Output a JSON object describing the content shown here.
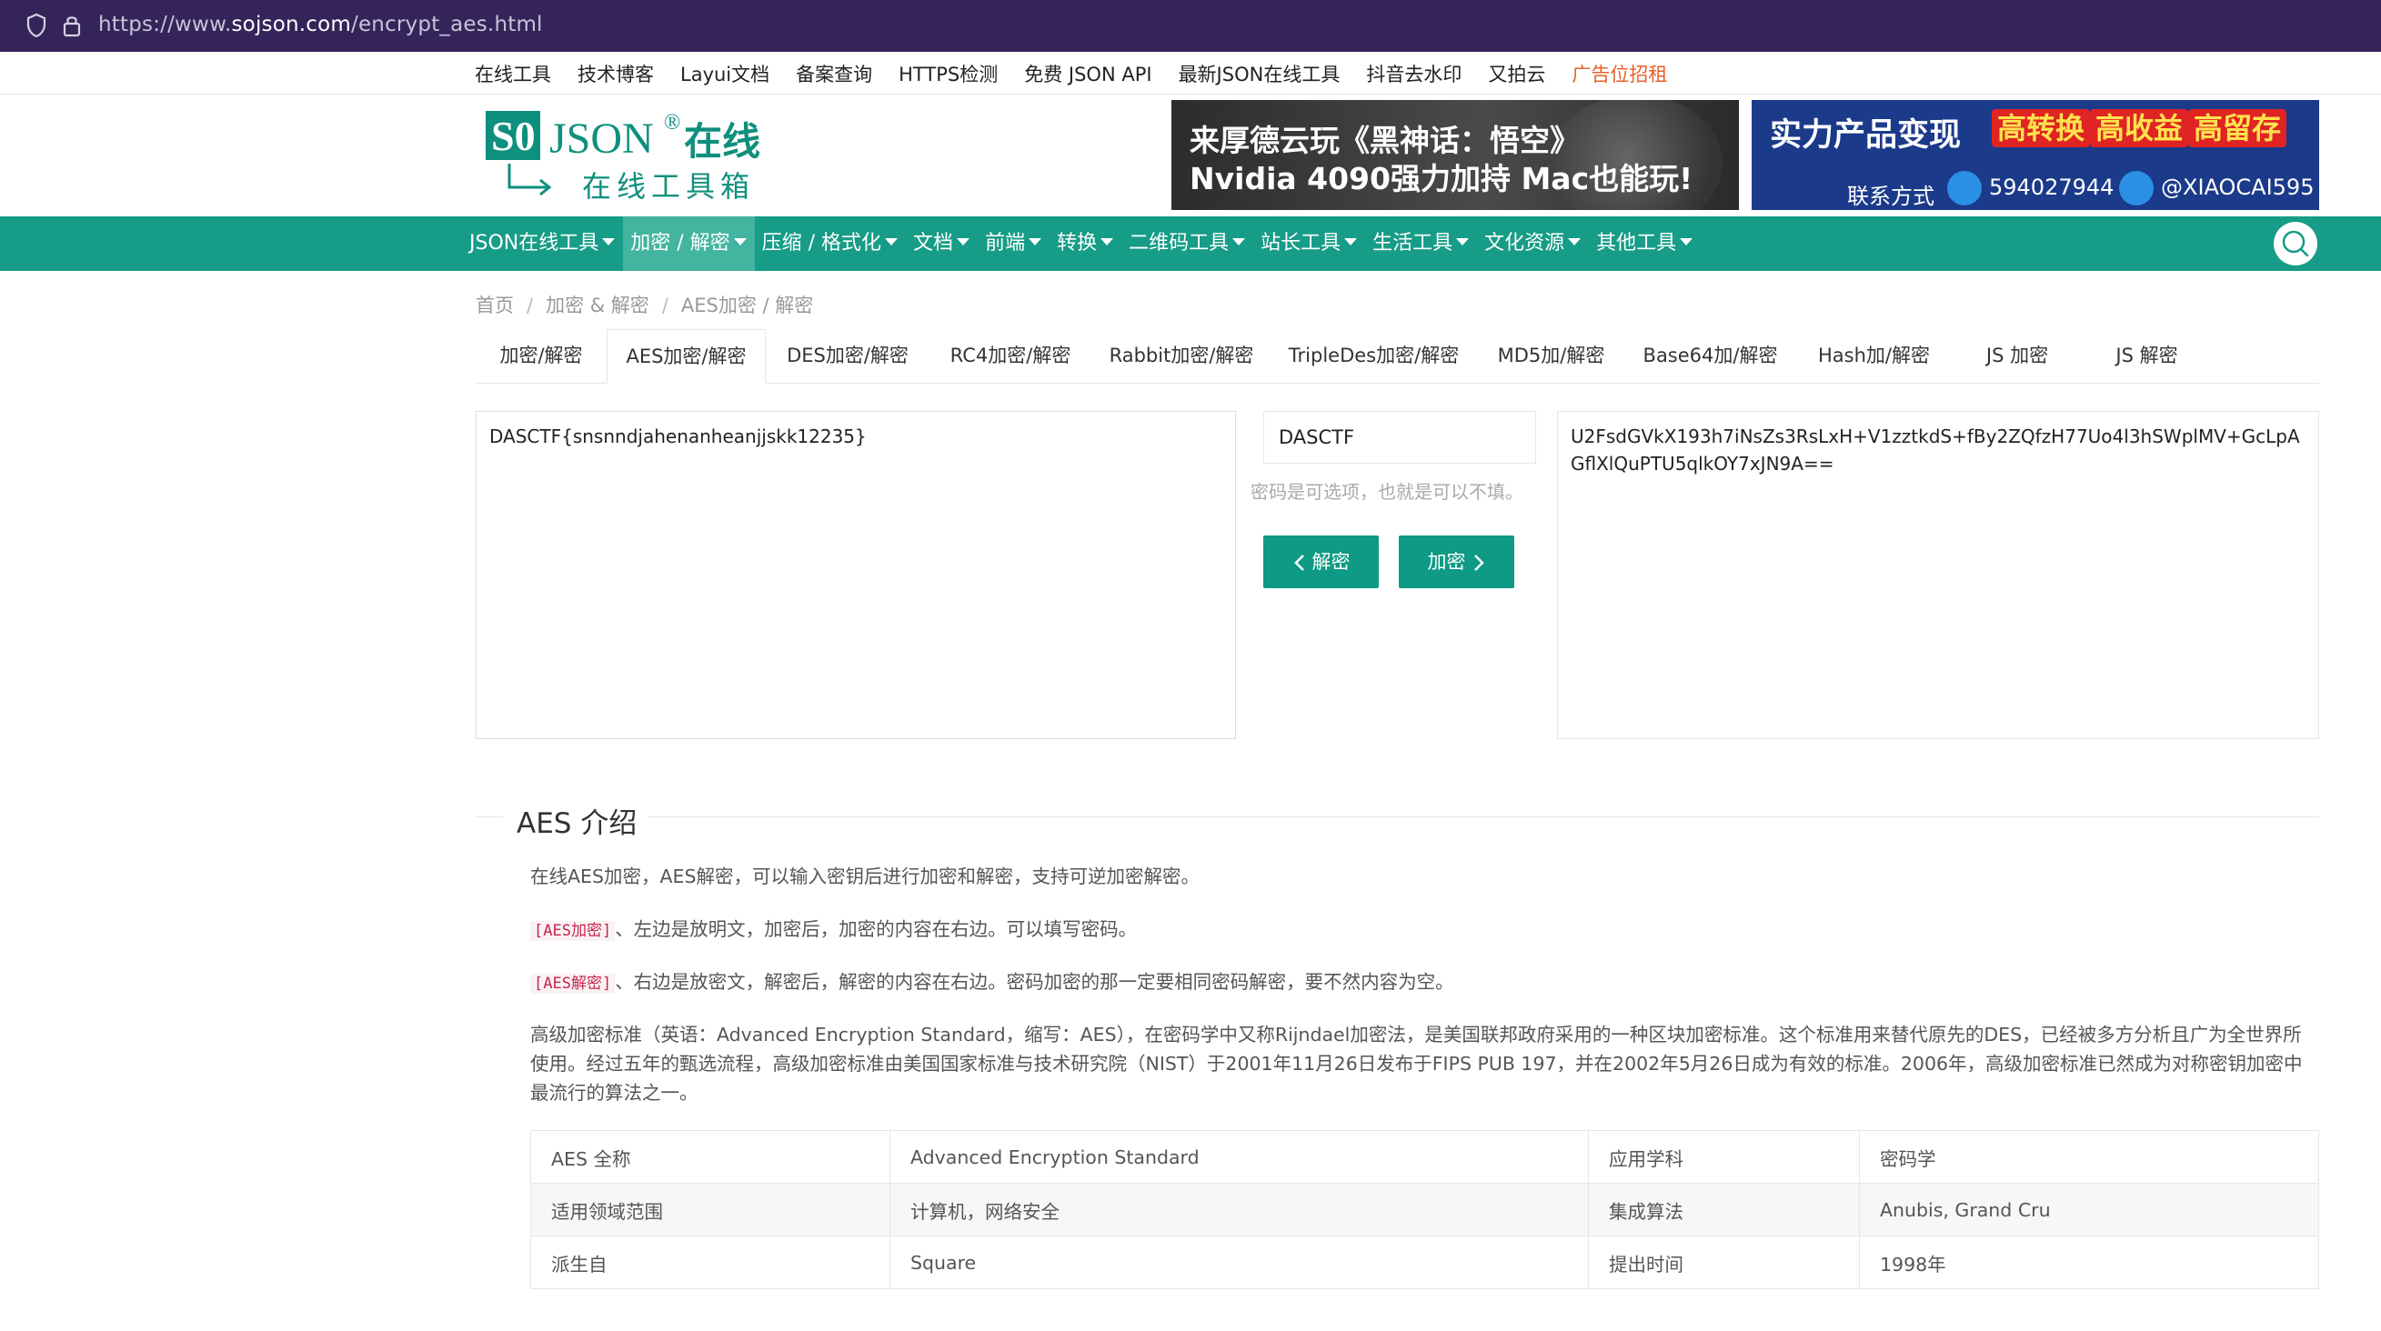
{
  "browser": {
    "url_prefix": "https://www.",
    "url_domain": "sojson.com",
    "url_path": "/encrypt_aes.html"
  },
  "top_links": [
    "在线工具",
    "技术博客",
    "Layui文档",
    "备案查询",
    "HTTPS检测",
    "免费 JSON API",
    "最新JSON在线工具",
    "抖音去水印",
    "又拍云",
    "广告位招租"
  ],
  "logo": {
    "brand": "SO JSON",
    "registered": "®",
    "zaixian": "在线",
    "subtitle": "在线工具箱"
  },
  "banner1": {
    "line1": "来厚德云玩《黑神话：悟空》",
    "line2": "Nvidia 4090强力加持 Mac也能玩!"
  },
  "banner2": {
    "title": "实力产品变现",
    "tags": [
      "高转换",
      "高收益",
      "高留存"
    ],
    "contact": "联系方式",
    "qq": "594027944",
    "telegram": "@XIAOCAI595"
  },
  "nav": {
    "items": [
      "JSON在线工具",
      "加密 / 解密",
      "压缩 / 格式化",
      "文档",
      "前端",
      "转换",
      "二维码工具",
      "站长工具",
      "生活工具",
      "文化资源",
      "其他工具"
    ],
    "active_index": 1
  },
  "breadcrumb": [
    "首页",
    "加密 & 解密",
    "AES加密 / 解密"
  ],
  "tabs": [
    "加密/解密",
    "AES加密/解密",
    "DES加密/解密",
    "RC4加密/解密",
    "Rabbit加密/解密",
    "TripleDes加密/解密",
    "MD5加/解密",
    "Base64加/解密",
    "Hash加/解密",
    "JS 加密",
    "JS 解密"
  ],
  "active_tab": "AES加密/解密",
  "tool": {
    "plaintext": "DASCTF{snsnndjahenanheanjjskk12235}",
    "password": "DASCTF",
    "password_hint": "密码是可选项，也就是可以不填。",
    "decrypt_label": "解密",
    "encrypt_label": "加密",
    "ciphertext": "U2FsdGVkX193h7iNsZs3RsLxH+V1zztkdS+fBy2ZQfzH77Uo4l3hSWplMV+GcLpAGflXlQuPTU5qlkOY7xJN9A=="
  },
  "intro": {
    "title": "AES 介绍",
    "p1": "在线AES加密，AES解密，可以输入密钥后进行加密和解密，支持可逆加密解密。",
    "p2_code": "[AES加密]",
    "p2_text": "、左边是放明文，加密后，加密的内容在右边。可以填写密码。",
    "p3_code": "[AES解密]",
    "p3_text": "、右边是放密文，解密后，解密的内容在右边。密码加密的那一定要相同密码解密，要不然内容为空。",
    "p4": "高级加密标准（英语：Advanced Encryption Standard，缩写：AES），在密码学中又称Rijndael加密法，是美国联邦政府采用的一种区块加密标准。这个标准用来替代原先的DES，已经被多方分析且广为全世界所使用。经过五年的甄选流程，高级加密标准由美国国家标准与技术研究院（NIST）于2001年11月26日发布于FIPS PUB 197，并在2002年5月26日成为有效的标准。2006年，高级加密标准已然成为对称密钥加密中最流行的算法之一。"
  },
  "table": [
    [
      "AES 全称",
      "Advanced Encryption Standard",
      "应用学科",
      "密码学"
    ],
    [
      "适用领域范围",
      "计算机，网络安全",
      "集成算法",
      "Anubis, Grand Cru"
    ],
    [
      "派生自",
      "Square",
      "提出时间",
      "1998年"
    ]
  ]
}
